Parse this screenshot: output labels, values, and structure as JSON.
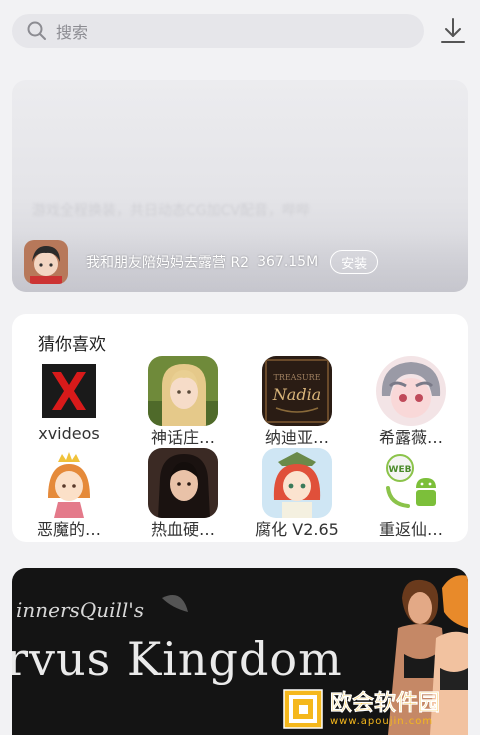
{
  "search": {
    "placeholder": "搜索",
    "icon": "search-icon"
  },
  "download": {
    "icon": "download-icon"
  },
  "banner": {
    "faded_text": "游戏全程换装，共日动态CG加CV配音，哔哔",
    "app": {
      "title": "我和朋友陪妈妈去露营 R2",
      "size": "367.15M",
      "install_label": "安装"
    }
  },
  "recommend": {
    "title": "猜你喜欢",
    "apps": [
      {
        "label": "xvideos",
        "icon": "xvideos-logo-icon"
      },
      {
        "label": "神话庄…",
        "icon": "blonde-girl-icon"
      },
      {
        "label": "纳迪亚…",
        "icon": "nadia-logo-icon"
      },
      {
        "label": "希露薇…",
        "icon": "anime-girl-icon"
      },
      {
        "label": "恶魔的…",
        "icon": "princess-icon"
      },
      {
        "label": "热血硬…",
        "icon": "dark-hair-girl-icon"
      },
      {
        "label": "腐化 V2.65",
        "icon": "red-hair-girl-icon"
      },
      {
        "label": "重返仙…",
        "icon": "android-web-icon"
      }
    ]
  },
  "promo": {
    "subtitle": "innersQuill's",
    "title": "rvus Kingdom"
  },
  "watermark": {
    "text": "欧会软件园",
    "url": "www.apoujin.com"
  },
  "colors": {
    "accent": "#f5b81c",
    "background": "#f2f2f4",
    "card": "#ffffff"
  }
}
